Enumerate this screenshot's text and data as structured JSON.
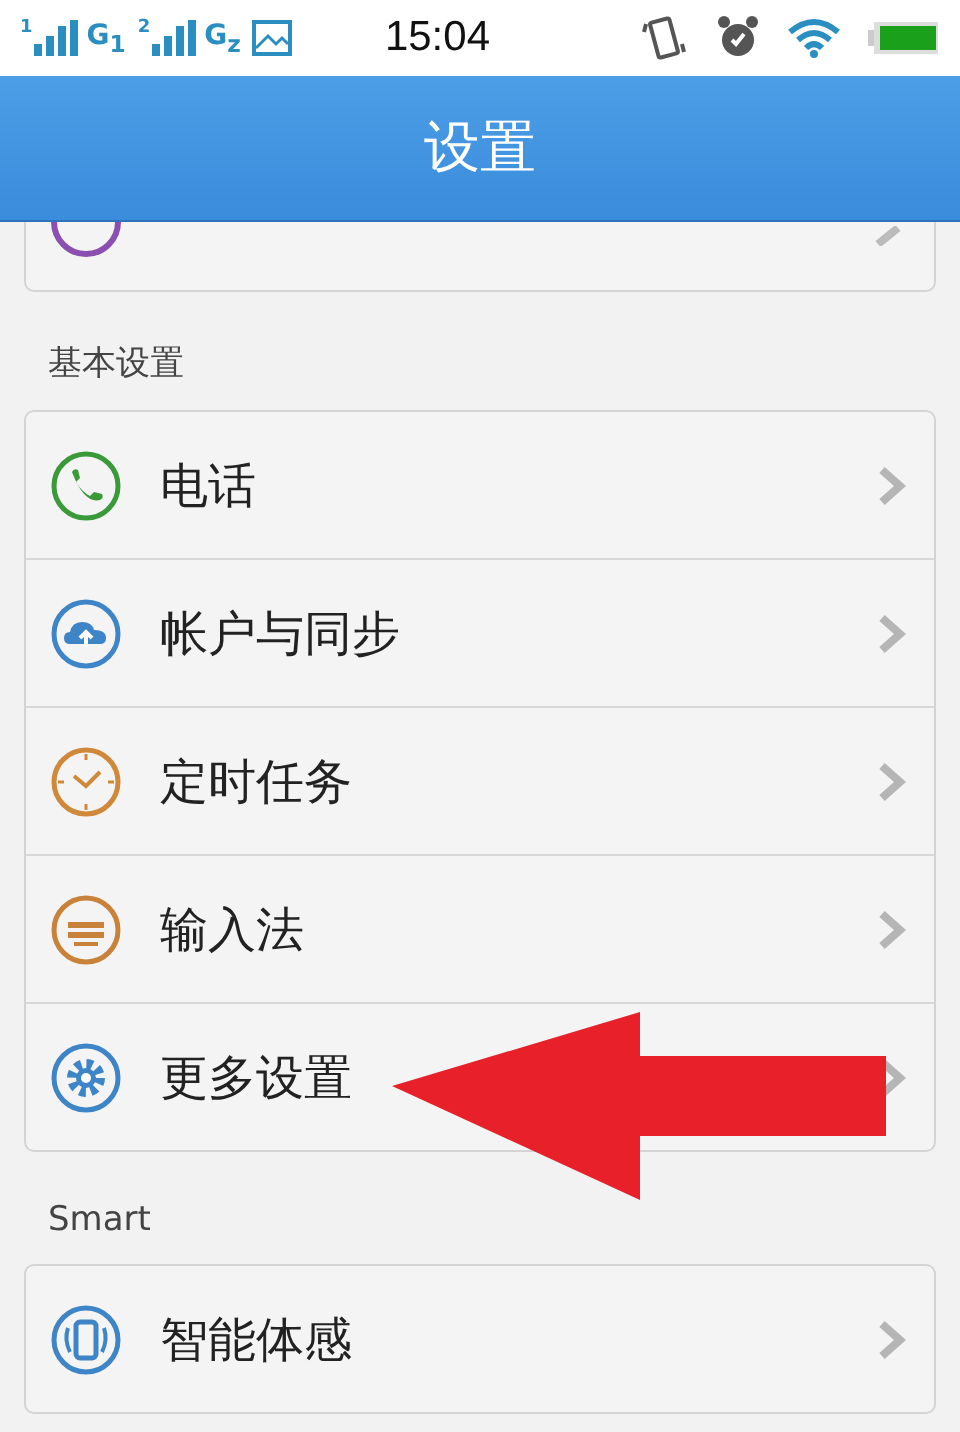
{
  "status_bar": {
    "sims": [
      {
        "slot": "1",
        "network": "G$_{1}$"
      },
      {
        "slot": "2",
        "network": "G$_{z}$"
      }
    ],
    "time": "15:04"
  },
  "header": {
    "title": "设置"
  },
  "sections": [
    {
      "title": "基本设置",
      "items": [
        {
          "label": "电话",
          "kind": "phone",
          "color": "#3a9a3a"
        },
        {
          "label": "帐户与同步",
          "kind": "cloud",
          "color": "#3d85c6"
        },
        {
          "label": "定时任务",
          "kind": "clock",
          "color": "#d0893a"
        },
        {
          "label": "输入法",
          "kind": "keyboard",
          "color": "#c9823a"
        },
        {
          "label": "更多设置",
          "kind": "gear",
          "color": "#3d85c6"
        }
      ]
    },
    {
      "title": "Smart",
      "items": [
        {
          "label": "智能体感",
          "kind": "motion",
          "color": "#3d85c6"
        }
      ]
    }
  ]
}
